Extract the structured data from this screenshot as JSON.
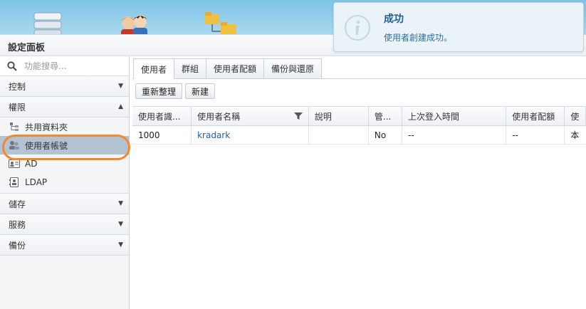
{
  "panel": {
    "title": "設定面板"
  },
  "search": {
    "placeholder": "功能搜尋..."
  },
  "sidebar": {
    "control": "控制",
    "privileges": {
      "label": "權限",
      "items": [
        {
          "label": "共用資料夾",
          "icon": "shared-folder-icon"
        },
        {
          "label": "使用者帳號",
          "icon": "user-accounts-icon"
        },
        {
          "label": "AD",
          "icon": "ad-icon"
        },
        {
          "label": "LDAP",
          "icon": "ldap-icon"
        }
      ]
    },
    "storage": "儲存",
    "services": "服務",
    "backup": "備份"
  },
  "tabs": [
    "使用者",
    "群組",
    "使用者配額",
    "備份與還原"
  ],
  "toolbar": {
    "refresh": "重新整理",
    "create": "新建"
  },
  "table": {
    "headers": [
      "使用者識...",
      "使用者名稱",
      "說明",
      "管...",
      "上次登入時間",
      "使用者配額",
      "使"
    ],
    "rows": [
      [
        "1000",
        "kradark",
        "",
        "No",
        "--",
        "--",
        "本"
      ]
    ]
  },
  "toast": {
    "title": "成功",
    "message": "使用者創建成功。"
  },
  "colors": {
    "accent": "#f08a2c",
    "link": "#1f5fa6",
    "selected": "#b3c3d3"
  }
}
